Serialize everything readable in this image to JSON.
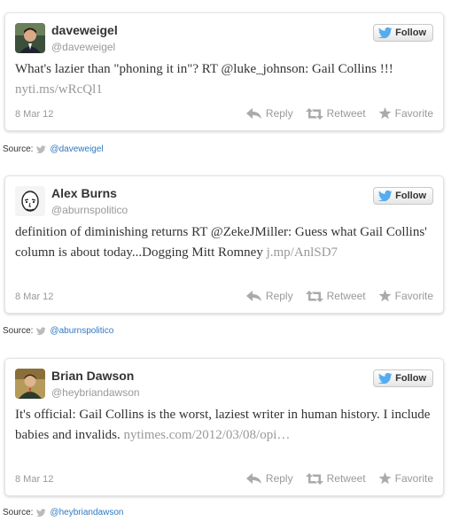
{
  "tweets": [
    {
      "name": "daveweigel",
      "handle": "@daveweigel",
      "follow_label": "Follow",
      "text": "What's lazier than \"phoning it in\"? RT @luke_johnson: Gail Collins !!! ",
      "link": "nyti.ms/wRcQl1",
      "date": "8 Mar 12",
      "reply_label": "Reply",
      "retweet_label": "Retweet",
      "favorite_label": "Favorite",
      "source_label": "Source:",
      "source_link": "@daveweigel"
    },
    {
      "name": "Alex Burns",
      "handle": "@aburnspolitico",
      "follow_label": "Follow",
      "text": "definition of diminishing returns RT @ZekeJMiller: Guess what Gail Collins' column is about today...Dogging Mitt Romney ",
      "link": "j.mp/AnlSD7",
      "date": "8 Mar 12",
      "reply_label": "Reply",
      "retweet_label": "Retweet",
      "favorite_label": "Favorite",
      "source_label": "Source:",
      "source_link": "@aburnspolitico"
    },
    {
      "name": "Brian Dawson",
      "handle": "@heybriandawson",
      "follow_label": "Follow",
      "text": "It's official: Gail Collins is the worst, laziest writer in human history. I include babies and invalids. ",
      "link": "nytimes.com/2012/03/08/opi…",
      "date": "8 Mar 12",
      "reply_label": "Reply",
      "retweet_label": "Retweet",
      "favorite_label": "Favorite",
      "source_label": "Source:",
      "source_link": "@heybriandawson"
    }
  ],
  "icons": {
    "follow": "twitter-bird-icon",
    "reply": "reply-arrow-icon",
    "retweet": "retweet-icon",
    "favorite": "star-icon",
    "source": "small-bird-icon"
  },
  "colors": {
    "link": "#2f78c0",
    "muted": "#999999",
    "text": "#333333",
    "bird": "#55acee"
  }
}
